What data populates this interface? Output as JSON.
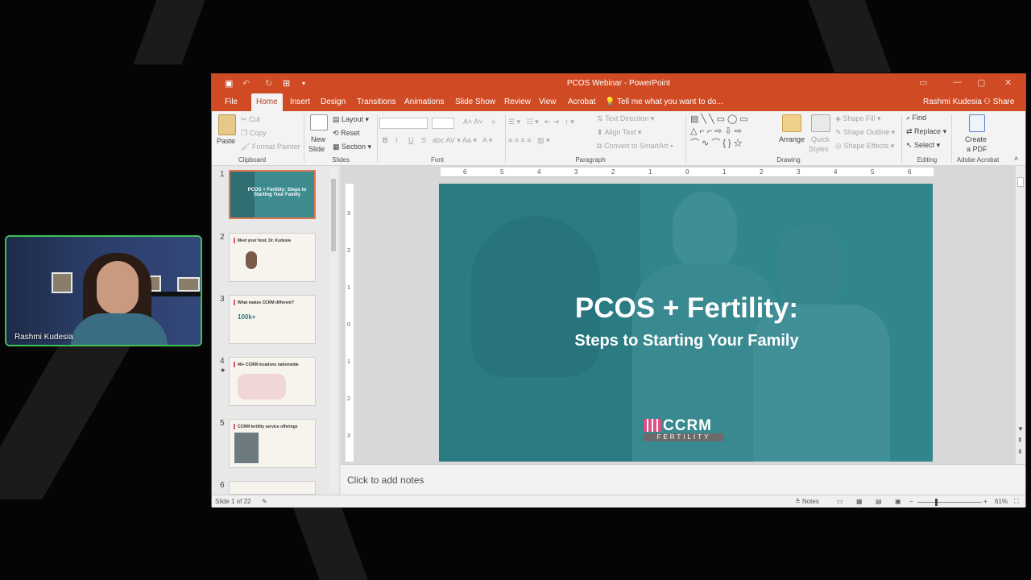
{
  "camera": {
    "name": "Rashmi Kudesia"
  },
  "window": {
    "title": "PCOS Webinar - PowerPoint",
    "tabs": [
      "File",
      "Home",
      "Insert",
      "Design",
      "Transitions",
      "Animations",
      "Slide Show",
      "Review",
      "View",
      "Acrobat"
    ],
    "tell_me": "Tell me what you want to do...",
    "user": "Rashmi Kudesia",
    "share": "Share"
  },
  "ribbon": {
    "clipboard": {
      "paste": "Paste",
      "cut": "Cut",
      "copy": "Copy",
      "format_painter": "Format Painter",
      "label": "Clipboard"
    },
    "slides": {
      "new_slide_1": "New",
      "new_slide_2": "Slide",
      "layout": "Layout",
      "reset": "Reset",
      "section": "Section",
      "label": "Slides"
    },
    "font": {
      "bold": "B",
      "italic": "I",
      "underline": "U",
      "strike": "S",
      "label": "Font"
    },
    "paragraph": {
      "text_direction": "Text Direction",
      "align_text": "Align Text",
      "convert": "Convert to SmartArt",
      "label": "Paragraph"
    },
    "drawing": {
      "arrange": "Arrange",
      "quick_styles_1": "Quick",
      "quick_styles_2": "Styles",
      "shape_fill": "Shape Fill",
      "shape_outline": "Shape Outline",
      "shape_effects": "Shape Effects",
      "label": "Drawing"
    },
    "editing": {
      "find": "Find",
      "replace": "Replace",
      "select": "Select",
      "label": "Editing"
    },
    "acrobat": {
      "create_1": "Create",
      "create_2": "a PDF",
      "label": "Adobe Acrobat"
    }
  },
  "thumbnails": [
    {
      "num": "1",
      "title": "PCOS + Fertility: Steps to Starting Your Family"
    },
    {
      "num": "2",
      "title": "Meet your host, Dr. Kudesia"
    },
    {
      "num": "3",
      "title": "What makes CCRM different?"
    },
    {
      "num": "4",
      "title": "40+ CCRM locations nationwide"
    },
    {
      "num": "5",
      "title": "CCRM fertility service offerings"
    },
    {
      "num": "6",
      "title": ""
    }
  ],
  "thumb3_stat": "100k+",
  "slide": {
    "title": "PCOS + Fertility:",
    "subtitle": "Steps to Starting Your Family",
    "logo_main": "CCRM",
    "logo_sub": "FERTILITY"
  },
  "ruler_h": [
    "6",
    "5",
    "4",
    "3",
    "2",
    "1",
    "0",
    "1",
    "2",
    "3",
    "4",
    "5",
    "6"
  ],
  "ruler_v": [
    "3",
    "2",
    "1",
    "0",
    "1",
    "2",
    "3"
  ],
  "notes_placeholder": "Click to add notes",
  "status": {
    "slide_count": "Slide 1 of 22",
    "notes": "Notes",
    "zoom": "61%"
  },
  "colors": {
    "accent": "#d04a24",
    "teal": "#3d8a8f",
    "cam_border": "#3fc15a"
  }
}
